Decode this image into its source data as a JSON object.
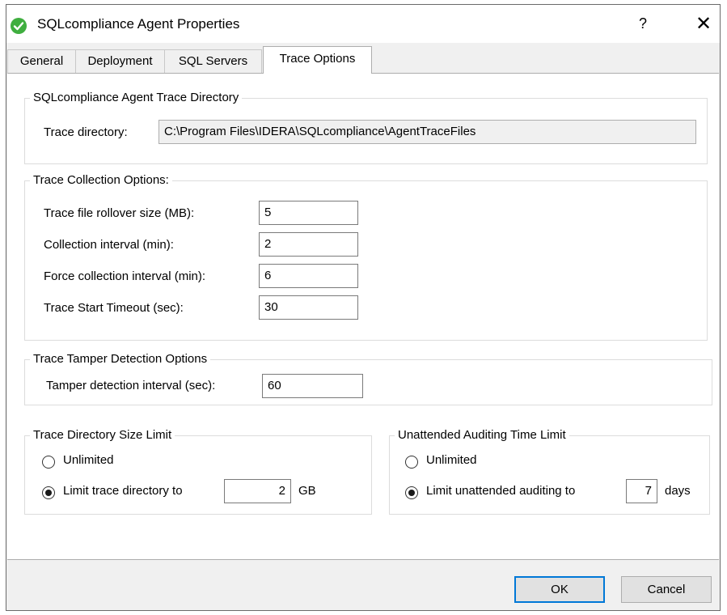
{
  "window": {
    "title": "SQLcompliance Agent Properties",
    "help_label": "?",
    "close_label": "✕"
  },
  "tabs": [
    {
      "label": "General"
    },
    {
      "label": "Deployment"
    },
    {
      "label": "SQL Servers"
    },
    {
      "label": "Trace Options",
      "active": true
    }
  ],
  "trace_directory": {
    "group_title": "SQLcompliance Agent Trace Directory",
    "label": "Trace directory:",
    "value": "C:\\Program Files\\IDERA\\SQLcompliance\\AgentTraceFiles"
  },
  "collection": {
    "group_title": "Trace Collection Options:",
    "fields": [
      {
        "label": "Trace file rollover size (MB):",
        "value": "5"
      },
      {
        "label": "Collection interval (min):",
        "value": "2"
      },
      {
        "label": "Force collection interval (min):",
        "value": "6"
      },
      {
        "label": "Trace Start Timeout (sec):",
        "value": "30"
      }
    ]
  },
  "tamper": {
    "group_title": "Trace Tamper Detection Options",
    "label": "Tamper detection interval (sec):",
    "value": "60"
  },
  "dir_size": {
    "group_title": "Trace Directory Size Limit",
    "unlimited_label": "Unlimited",
    "limit_label": "Limit trace directory to",
    "limit_value": "2",
    "unit": "GB",
    "selected": "limit"
  },
  "unattended": {
    "group_title": "Unattended Auditing Time Limit",
    "unlimited_label": "Unlimited",
    "limit_label": "Limit unattended auditing to",
    "limit_value": "7",
    "unit": "days",
    "selected": "limit"
  },
  "footer": {
    "ok_label": "OK",
    "cancel_label": "Cancel"
  },
  "colors": {
    "accent": "#0078d7",
    "app_icon": "#3fae3f"
  },
  "icons": {
    "app": "check-circle-icon",
    "radio_checked": "radio-checked-icon",
    "radio_unchecked": "radio-unchecked-icon"
  }
}
